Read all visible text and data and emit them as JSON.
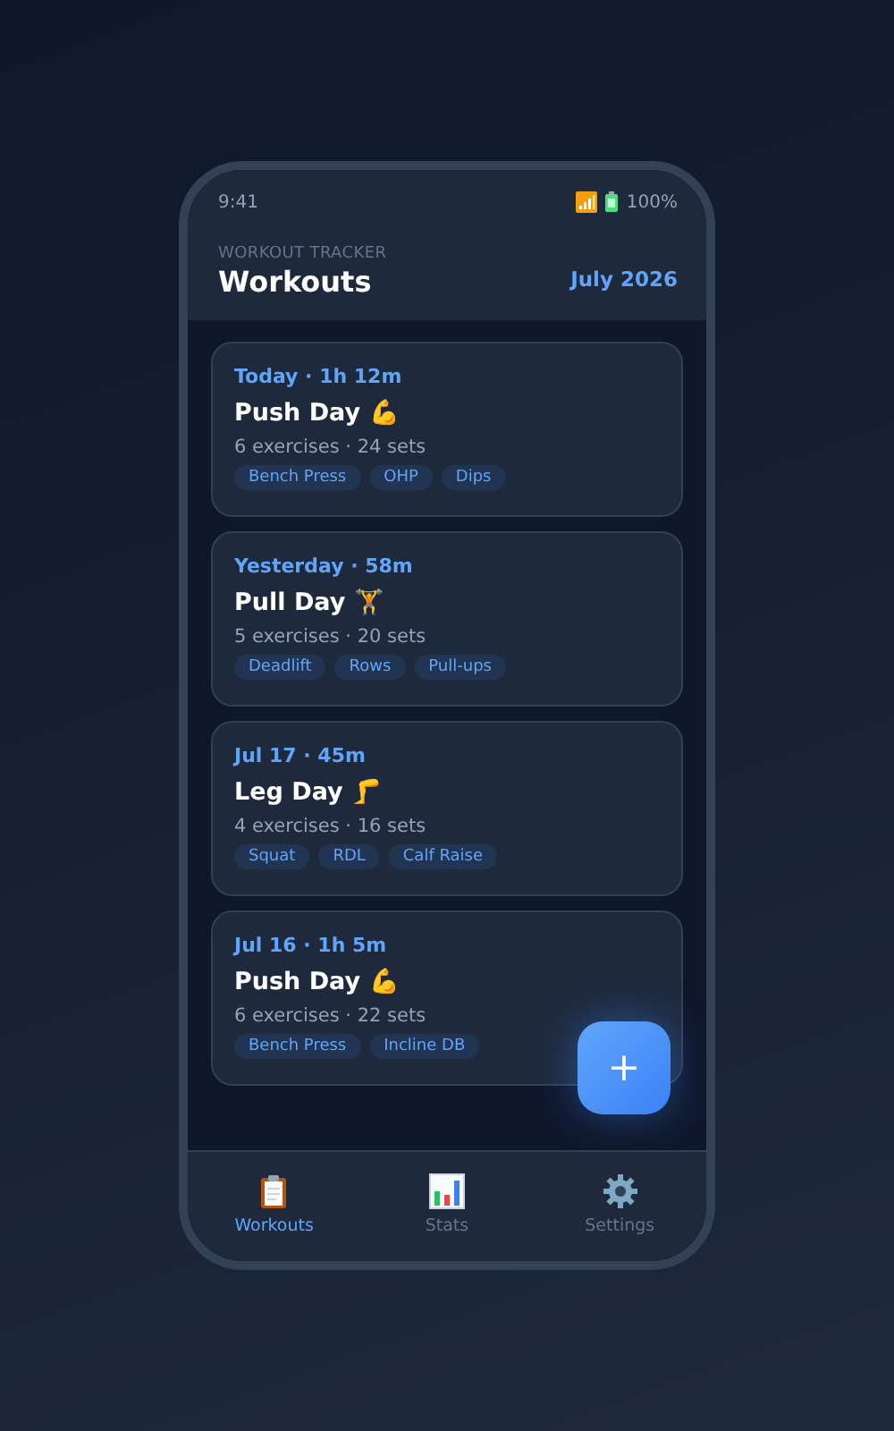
{
  "status_bar": {
    "time": "9:41",
    "battery": "100%"
  },
  "header": {
    "eyebrow": "WORKOUT TRACKER",
    "title": "Workouts",
    "month": "July 2026"
  },
  "workouts": [
    {
      "meta": "Today · 1h 12m",
      "title": "Push Day 💪",
      "summary": "6 exercises · 24 sets",
      "tags": [
        "Bench Press",
        "OHP",
        "Dips"
      ]
    },
    {
      "meta": "Yesterday · 58m",
      "title": "Pull Day 🏋",
      "summary": "5 exercises · 20 sets",
      "tags": [
        "Deadlift",
        "Rows",
        "Pull-ups"
      ]
    },
    {
      "meta": "Jul 17 · 45m",
      "title": "Leg Day 🦵",
      "summary": "4 exercises · 16 sets",
      "tags": [
        "Squat",
        "RDL",
        "Calf Raise"
      ]
    },
    {
      "meta": "Jul 16 · 1h 5m",
      "title": "Push Day 💪",
      "summary": "6 exercises · 22 sets",
      "tags": [
        "Bench Press",
        "Incline DB"
      ]
    }
  ],
  "fab": {
    "label": "+"
  },
  "tabs": [
    {
      "kind": "clipboard",
      "label": "Workouts",
      "selected": true
    },
    {
      "kind": "chart",
      "label": "Stats",
      "selected": false
    },
    {
      "kind": "gear",
      "label": "Settings",
      "selected": false
    }
  ]
}
